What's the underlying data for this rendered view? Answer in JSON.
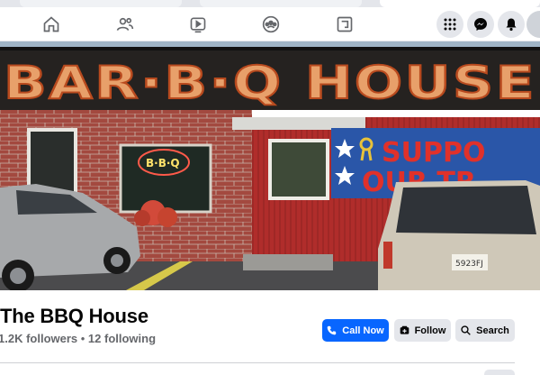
{
  "nav": {
    "icons": [
      "home-icon",
      "friends-icon",
      "video-icon",
      "groups-icon",
      "gaming-icon"
    ],
    "right_icons": [
      "menu-grid-icon",
      "messenger-icon",
      "notifications-icon"
    ]
  },
  "cover": {
    "sign_text": "BAR·B·Q HOUSE",
    "neon_text": "B·B·Q",
    "banner_text_line1": "SUPPO",
    "banner_text_line2": "OUR TR",
    "plate_text": "5923FJ"
  },
  "page": {
    "name": "The BBQ House",
    "followers": "1.2K followers",
    "separator": " • ",
    "following": "12 following"
  },
  "actions": {
    "call_label": "Call Now",
    "follow_label": "Follow",
    "search_label": "Search"
  },
  "colors": {
    "primary": "#0866ff",
    "secondary_bg": "#e4e6eb",
    "muted_text": "#65676b"
  }
}
